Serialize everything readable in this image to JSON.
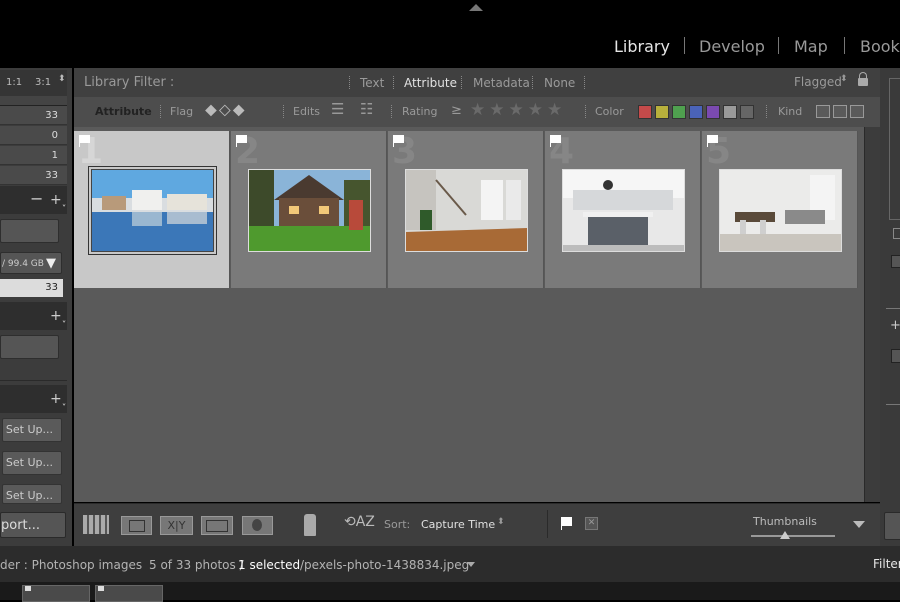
{
  "modules": [
    "Library",
    "Develop",
    "Map",
    "Book"
  ],
  "active_module": "Library",
  "left_panel": {
    "zoom_labels": [
      "1:1",
      "3:1"
    ],
    "catalog_counts": [
      "33",
      "0",
      "1",
      "33"
    ],
    "volume": "/ 99.4 GB",
    "folder_count": "33",
    "setup_buttons": [
      "Set Up...",
      "Set Up...",
      "Set Up..."
    ],
    "export_button": "port..."
  },
  "filter": {
    "title": "Library Filter :",
    "tabs": [
      "Text",
      "Attribute",
      "Metadata",
      "None"
    ],
    "active_tab": "Attribute",
    "preset": "Flagged"
  },
  "attribute_bar": {
    "attribute_label": "Attribute",
    "flag_label": "Flag",
    "edits_label": "Edits",
    "rating_label": "Rating",
    "rating_op": "≥",
    "color_label": "Color",
    "kind_label": "Kind",
    "colors": [
      "#c44a4a",
      "#b8b03c",
      "#4fa04f",
      "#4a63b8",
      "#7b4ab0",
      "#9a9a9a",
      "#666666"
    ]
  },
  "grid": {
    "cells": [
      {
        "number": "1",
        "selected": true,
        "thumb": "lake-houses"
      },
      {
        "number": "2",
        "selected": false,
        "thumb": "craftsman-house"
      },
      {
        "number": "3",
        "selected": false,
        "thumb": "interior-stairs"
      },
      {
        "number": "4",
        "selected": false,
        "thumb": "kitchen"
      },
      {
        "number": "5",
        "selected": false,
        "thumb": "living-dining"
      }
    ]
  },
  "toolbar": {
    "sort_label": "Sort:",
    "sort_value": "Capture Time",
    "thumbnails_label": "Thumbnails",
    "thumb_size_percent": 40
  },
  "status": {
    "source": "der : Photoshop images",
    "photo_count": "5 of 33 photos /",
    "selected": "1 selected",
    "filename": "/pexels-photo-1438834.jpeg",
    "filter_label": "Filter"
  }
}
